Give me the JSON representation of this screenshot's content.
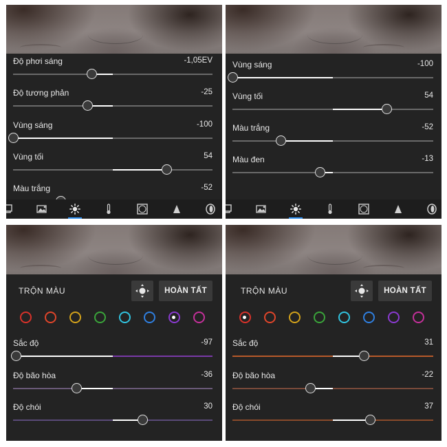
{
  "panel1": {
    "sliders": [
      {
        "label": "Độ phơi sáng",
        "value": "-1,05EV",
        "level": -0.21
      },
      {
        "label": "Độ tương phản",
        "value": "-25",
        "level": -0.25
      },
      {
        "label": "Vùng sáng",
        "value": "-100",
        "level": -1.0
      },
      {
        "label": "Vùng tối",
        "value": "54",
        "level": 0.54
      },
      {
        "label": "Màu trắng",
        "value": "-52",
        "level": -0.52
      }
    ]
  },
  "panel2": {
    "sliders": [
      {
        "label": "Vùng sáng",
        "value": "-100",
        "level": -1.0
      },
      {
        "label": "Vùng tối",
        "value": "54",
        "level": 0.54
      },
      {
        "label": "Màu trắng",
        "value": "-52",
        "level": -0.52
      },
      {
        "label": "Màu đen",
        "value": "-13",
        "level": -0.13
      }
    ]
  },
  "toolbar": {
    "tools": [
      "presets-icon",
      "image-adjust-icon",
      "light-icon",
      "color-temperature-icon",
      "vignette-icon",
      "detail-triangle-icon",
      "optics-lens-icon"
    ],
    "active": "light-icon",
    "accent": "#2d8ceb"
  },
  "mix_left": {
    "title": "TRỘN MÀU",
    "done_label": "HOÀN TẤT",
    "selected_color": "purple",
    "colors": [
      "#d8322a",
      "#e0452a",
      "#d3a21b",
      "#3aa43a",
      "#31c4e0",
      "#2f7fe0",
      "#8a3ad0",
      "#c4309a"
    ],
    "sliders": [
      {
        "label": "Sắc độ",
        "value": "-97",
        "level": -0.97,
        "track": "#7a3aa8"
      },
      {
        "label": "Độ bão hòa",
        "value": "-36",
        "level": -0.36,
        "track": "#6a5a78"
      },
      {
        "label": "Độ chói",
        "value": "30",
        "level": 0.3,
        "track": "#5a4a78"
      }
    ]
  },
  "mix_right": {
    "title": "TRỘN MÀU",
    "done_label": "HOÀN TẤT",
    "selected_color": "red",
    "colors": [
      "#d8322a",
      "#e0452a",
      "#d3a21b",
      "#3aa43a",
      "#31c4e0",
      "#2f7fe0",
      "#8a3ad0",
      "#c4309a"
    ],
    "sliders": [
      {
        "label": "Sắc độ",
        "value": "31",
        "level": 0.31,
        "track": "#b85a2a"
      },
      {
        "label": "Độ bão hòa",
        "value": "-22",
        "level": -0.22,
        "track": "#7a4a3a"
      },
      {
        "label": "Độ chói",
        "value": "37",
        "level": 0.37,
        "track": "#8a4a2a"
      }
    ]
  }
}
